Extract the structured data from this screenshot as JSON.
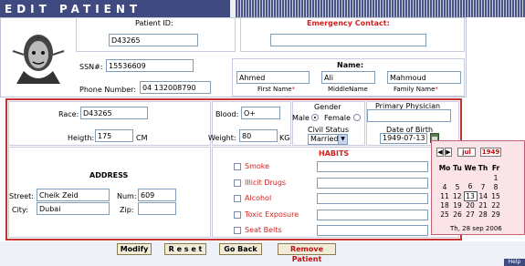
{
  "header": {
    "title": "EDIT PATIENT"
  },
  "ids": {
    "patient_id_label": "Patient ID:",
    "patient_id": "D43265",
    "emergency_label": "Emergency Contact:",
    "emergency_value": "",
    "ssn_label": "SSN#:",
    "ssn": "15536609",
    "phone_label": "Phone Number:",
    "phone": "04 132008790",
    "name_label": "Name:",
    "first_name": "Ahmed",
    "first_name_label": "First Name",
    "middle_name": "Ali",
    "middle_name_label": "MiddleName",
    "family_name": "Mahmoud",
    "family_name_label": "Family Name",
    "required_mark": "*"
  },
  "details": {
    "race_label": "Race:",
    "race": "D43265",
    "blood_label": "Blood:",
    "blood": "O+",
    "gender_label": "Gender",
    "male_label": "Male",
    "female_label": "Female",
    "physician_label": "Primary Physician",
    "physician": "",
    "height_label": "Heigth:",
    "height": "175",
    "height_unit": "CM",
    "weight_label": "Weight:",
    "weight": "80",
    "weight_unit": "KG",
    "civil_label": "Civil Status",
    "civil_value": "Married",
    "dob_label": "Date of Birth",
    "dob": "1949-07-13"
  },
  "address": {
    "heading": "ADDRESS",
    "street_label": "Street:",
    "street": "Cheik Zeid",
    "num_label": "Num:",
    "num": "609",
    "city_label": "City:",
    "city": "Dubai",
    "zip_label": "Zip:",
    "zip": ""
  },
  "habits": {
    "heading": "HABITS",
    "items": [
      "Smoke",
      "Illicit Drugs",
      "Alcohol",
      "Toxic Exposure",
      "Seat Belts"
    ]
  },
  "buttons": {
    "modify": "Modify",
    "reset": "R e s e t",
    "goback": "Go Back",
    "remove": "Remove Patient"
  },
  "calendar": {
    "month": "jul",
    "year": "1949",
    "days": [
      "Mo",
      "Tu",
      "We",
      "Th",
      "Fr"
    ],
    "weeks": [
      [
        "",
        "",
        "",
        "",
        "1"
      ],
      [
        "4",
        "5",
        "6",
        "7",
        "8"
      ],
      [
        "11",
        "12",
        "13",
        "14",
        "15"
      ],
      [
        "18",
        "19",
        "20",
        "21",
        "22"
      ],
      [
        "25",
        "26",
        "27",
        "28",
        "29"
      ]
    ],
    "today": "Th, 28 sep 2006"
  },
  "help_label": "Help",
  "colors": {
    "title_bar": "#3f4a80",
    "accent_red": "#d42020",
    "frame_red": "#c83232",
    "calendar_bg": "#fbe4e8"
  }
}
